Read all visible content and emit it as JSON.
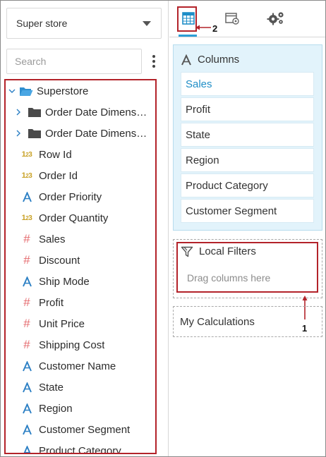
{
  "datasource": {
    "selected": "Super store"
  },
  "search": {
    "placeholder": "Search"
  },
  "tree": {
    "root": "Superstore",
    "folders": [
      "Order Date Dimens…",
      "Order Date Dimens…"
    ],
    "fields": [
      {
        "label": "Row Id",
        "type": "numeric",
        "icon": "numeric-icon"
      },
      {
        "label": "Order Id",
        "type": "numeric",
        "icon": "numeric-icon"
      },
      {
        "label": "Order Priority",
        "type": "attribute",
        "icon": "attribute-icon"
      },
      {
        "label": "Order Quantity",
        "type": "numeric",
        "icon": "numeric-icon"
      },
      {
        "label": "Sales",
        "type": "measure",
        "icon": "hash-icon"
      },
      {
        "label": "Discount",
        "type": "measure",
        "icon": "hash-icon"
      },
      {
        "label": "Ship Mode",
        "type": "attribute",
        "icon": "attribute-icon"
      },
      {
        "label": "Profit",
        "type": "measure",
        "icon": "hash-icon"
      },
      {
        "label": "Unit Price",
        "type": "measure",
        "icon": "hash-icon"
      },
      {
        "label": "Shipping Cost",
        "type": "measure",
        "icon": "hash-icon"
      },
      {
        "label": "Customer Name",
        "type": "attribute",
        "icon": "attribute-icon"
      },
      {
        "label": "State",
        "type": "attribute",
        "icon": "attribute-icon"
      },
      {
        "label": "Region",
        "type": "attribute",
        "icon": "attribute-icon"
      },
      {
        "label": "Customer Segment",
        "type": "attribute",
        "icon": "attribute-icon"
      },
      {
        "label": "Product Category",
        "type": "attribute",
        "icon": "attribute-icon"
      }
    ]
  },
  "tabs": [
    {
      "name": "table-icon",
      "active": true
    },
    {
      "name": "window-gear-icon",
      "active": false
    },
    {
      "name": "gears-icon",
      "active": false
    }
  ],
  "columns": {
    "title": "Columns",
    "items": [
      "Sales",
      "Profit",
      "State",
      "Region",
      "Product Category",
      "Customer Segment"
    ],
    "selected_index": 0
  },
  "local_filters": {
    "title": "Local Filters",
    "hint": "Drag columns here"
  },
  "calculations": {
    "title": "My Calculations"
  },
  "callouts": {
    "one": "1",
    "two": "2"
  },
  "colors": {
    "accent": "#1f8ec7",
    "highlight_border": "#b3232a",
    "numeric_icon": "#c9a227",
    "measure_icon": "#e56b6f",
    "attribute_icon": "#2b7fc4",
    "columns_panel_bg": "#e2f3fb"
  }
}
